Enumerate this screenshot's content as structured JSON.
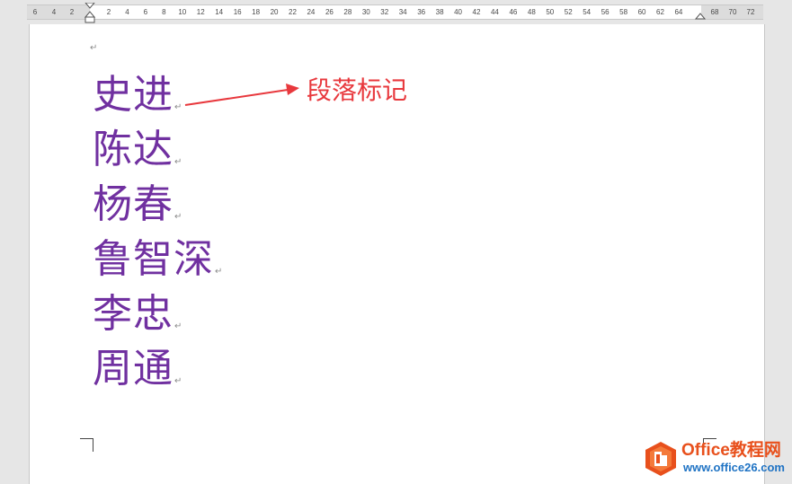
{
  "ruler": {
    "left_ticks": [
      "6",
      "4",
      "2"
    ],
    "right_ticks": [
      "2",
      "4",
      "6",
      "8",
      "10",
      "12",
      "14",
      "16",
      "18",
      "20",
      "22",
      "24",
      "26",
      "28",
      "30",
      "32",
      "34",
      "36",
      "38",
      "40",
      "42",
      "44",
      "46",
      "48",
      "50",
      "52",
      "54",
      "56",
      "58",
      "60",
      "62",
      "64"
    ],
    "margin_ticks": [
      "68",
      "70",
      "72"
    ]
  },
  "document": {
    "paragraphs": [
      "史进",
      "陈达",
      "杨春",
      "鲁智深",
      "李忠",
      "周通"
    ],
    "paragraph_mark": "↵",
    "text_color": "#7030a0"
  },
  "annotation": {
    "label": "段落标记",
    "color": "#e8383d"
  },
  "watermark": {
    "brand": "Office教程网",
    "url": "www.office26.com"
  }
}
